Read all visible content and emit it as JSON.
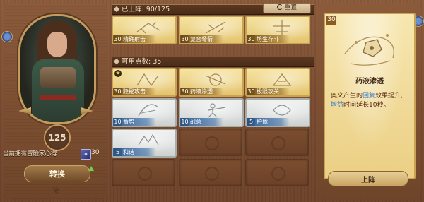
{
  "left": {
    "level": "125",
    "owned_text": "当前拥有冒险家心得",
    "owned_icon_glyph": "✦",
    "owned_count": "30",
    "switch_label": "转换"
  },
  "deployed": {
    "title": "已上阵: 90/125",
    "reset_label": "重置",
    "slots": [
      {
        "pts": "30",
        "name": "精确射击",
        "style": "gold"
      },
      {
        "pts": "30",
        "name": "复合弩箭",
        "style": "gold"
      },
      {
        "pts": "30",
        "name": "坊生存斗",
        "style": "gold"
      }
    ]
  },
  "available": {
    "title": "可用点数: 35",
    "row1": [
      {
        "pts": "30",
        "name": "隐秘攻击",
        "style": "gold",
        "selected": true
      },
      {
        "pts": "30",
        "name": "药液渗透",
        "style": "gold"
      },
      {
        "pts": "30",
        "name": "极限攻关",
        "style": "gold"
      }
    ],
    "row2": [
      {
        "pts": "10",
        "name": "蓄势",
        "style": "silver"
      },
      {
        "pts": "10",
        "name": "战意",
        "style": "silver"
      },
      {
        "pts": "5",
        "name": "护体",
        "style": "silver"
      }
    ],
    "row3": [
      {
        "pts": "5",
        "name": "和谐",
        "style": "silver"
      }
    ]
  },
  "detail": {
    "pts": "30",
    "name": "药液渗透",
    "desc_1": "奥义产生的",
    "desc_hl1": "回复",
    "desc_2": "效果提升,",
    "desc_hl2": "增益",
    "desc_3": "时间延长10秒。",
    "deploy_label": "上阵"
  }
}
